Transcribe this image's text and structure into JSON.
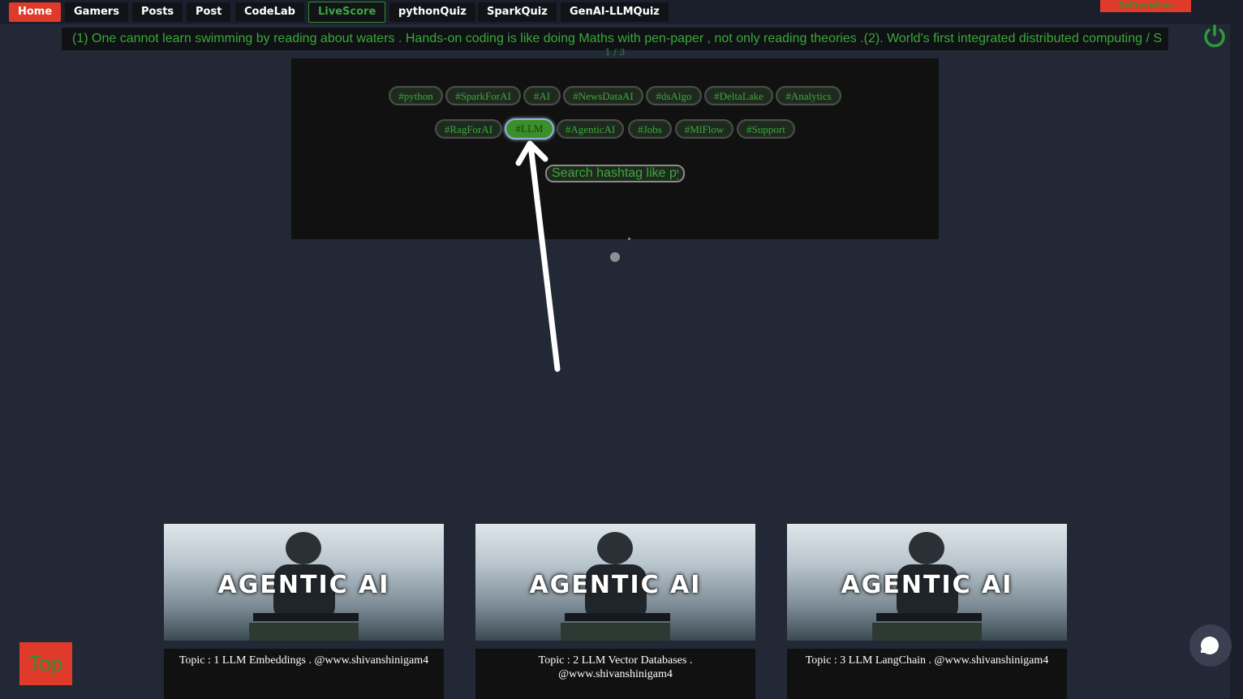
{
  "nav": {
    "items": [
      "Home",
      "Gamers",
      "Posts",
      "Post",
      "CodeLab",
      "LiveScore",
      "pythonQuiz",
      "SparkQuiz",
      "GenAI-LLMQuiz"
    ],
    "refresh_label": "ReFreshPins"
  },
  "marquee": {
    "text": "(1) One cannot learn swimming by reading about waters . Hands-on coding is like doing Maths with pen-paper , not only reading theories .(2). World's first integrated distributed computing / S"
  },
  "slider": {
    "counter": "1 / 3"
  },
  "hashtags": {
    "row1": [
      "#python",
      "#SparkForAI",
      "#AI",
      "#NewsDataAI",
      "#dsAlgo",
      "#DeltaLake",
      "#Analytics"
    ],
    "row2": [
      "#RagForAI",
      "#LLM",
      "#AgenticAI",
      "#Jobs",
      "#MlFlow",
      "#Support"
    ],
    "active": "#LLM"
  },
  "search": {
    "placeholder": "Search hashtag like py"
  },
  "cards": [
    {
      "image_title": "AGENTIC AI",
      "caption": "Topic : 1 LLM Embeddings . @www.shivanshinigam4"
    },
    {
      "image_title": "AGENTIC AI",
      "caption": "Topic : 2 LLM Vector Databases . @www.shivanshinigam4"
    },
    {
      "image_title": "AGENTIC AI",
      "caption": "Topic : 3 LLM LangChain . @www.shivanshinigam4"
    }
  ],
  "top_button": "Top",
  "icons": {
    "power": "power-icon",
    "chat": "chat-icon"
  },
  "colors": {
    "accent_red": "#e03a2a",
    "accent_green": "#3aa83a",
    "background": "#222836"
  }
}
